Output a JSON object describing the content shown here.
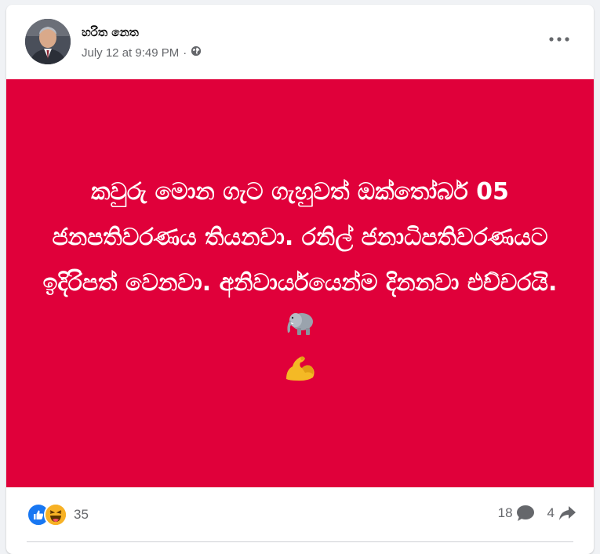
{
  "post": {
    "author": "හරිත නෙත",
    "timestamp": "July 12 at 9:49 PM",
    "separator": "·",
    "audience_icon": "globe-icon",
    "background_color": "#e0003a",
    "text": "කවුරු මොන ගැට ගැහුවත් ඔක්තෝබර් 05 ජනපතිවරණය තියනවා. රනිල් ජනාධිපතිවරණයට ඉදිරිපත් වෙනවා. අනිවාර්යයෙන්ම දිනනවා එච්චරයි.",
    "emojis": [
      "elephant-emoji",
      "flexed-biceps-emoji"
    ]
  },
  "reactions": {
    "types": [
      "like-icon",
      "haha-icon"
    ],
    "count": "35"
  },
  "stats": {
    "comments": "18",
    "shares": "4"
  },
  "colors": {
    "like_blue": "#1877f2",
    "haha_yellow": "#f7b125",
    "muted_text": "#65676b"
  }
}
